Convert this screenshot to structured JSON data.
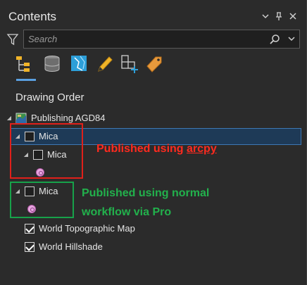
{
  "window": {
    "title": "Contents"
  },
  "search": {
    "placeholder": "Search"
  },
  "toolbar": {
    "tools": [
      "list-by-drawing-order-icon",
      "list-by-data-source-icon",
      "list-by-selection-icon",
      "list-by-editing-icon",
      "list-by-snapping-icon",
      "list-by-labeling-icon"
    ]
  },
  "section": {
    "title": "Drawing Order"
  },
  "layers": {
    "map": "Publishing AGD84",
    "group": "Mica",
    "sublayer": "Mica",
    "normal": "Mica",
    "topo": "World Topographic Map",
    "hillshade": "World Hillshade"
  },
  "annotations": {
    "red_prefix": "Published using ",
    "red_underlined": "arcpy",
    "green_line1": "Published using normal",
    "green_line2": "workflow via Pro"
  },
  "colors": {
    "accent": "#3d78b4",
    "annotation_red": "#ff2a1f",
    "annotation_green": "#22b14c",
    "box_red": "#e0201a",
    "box_green": "#17a24a",
    "point_symbol": "#e8a8e0"
  }
}
